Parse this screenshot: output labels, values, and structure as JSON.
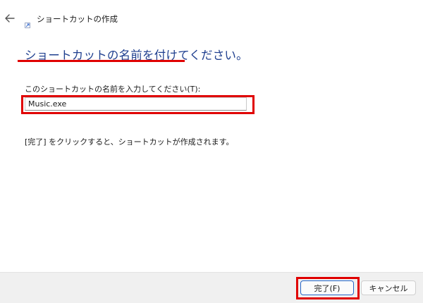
{
  "window": {
    "title": "ショートカットの作成",
    "back_icon": "back-arrow-icon",
    "app_icon": "shortcut-app-icon"
  },
  "main": {
    "heading": "ショートカットの名前を付けてください。",
    "field_label": "このショートカットの名前を入力してください(T):",
    "field_value": "Music.exe",
    "instruction": "[完了] をクリックすると、ショートカットが作成されます。"
  },
  "footer": {
    "finish_label": "完了(F)",
    "cancel_label": "キャンセル"
  },
  "colors": {
    "heading": "#1f3f8f",
    "highlight": "#e00000",
    "footer_background": "#f0f0f0",
    "primary_border": "#2565c7"
  }
}
